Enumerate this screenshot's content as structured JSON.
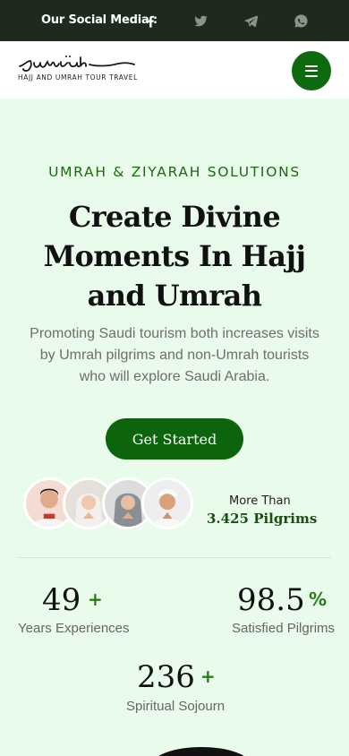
{
  "topbar": {
    "social_label": "Our Social Media :",
    "icons": [
      "facebook-icon",
      "twitter-icon",
      "telegram-icon",
      "whatsapp-icon"
    ]
  },
  "header": {
    "logo_text": "Jumrah",
    "logo_tagline": "HAJJ AND UMRAH TOUR TRAVEL",
    "menu_icon": "hamburger-menu-icon"
  },
  "hero": {
    "eyebrow": "UMRAH & ZIYARAH SOLUTIONS",
    "headline_lines": [
      "Create Divine",
      "Moments In Hajj",
      "and Umrah"
    ],
    "description": "Promoting Saudi tourism both increases visits by Umrah pilgrims and non-Umrah tourists who will explore Saudi Arabia.",
    "cta_label": "Get Started"
  },
  "pilgrims": {
    "more_than": "More Than",
    "count_text": "3.425 Pilgrims"
  },
  "stats": [
    {
      "value": "49",
      "suffix": "+",
      "label": "Years Experiences"
    },
    {
      "value": "98.5",
      "suffix": "%",
      "label": "Satisfied Pilgrims"
    },
    {
      "value": "236",
      "suffix": "+",
      "label": "Spiritual Sojourn"
    }
  ],
  "colors": {
    "brand_green": "#0c640c",
    "accent_green": "#2a7b1c",
    "page_bg": "#e9fbea",
    "topbar_bg": "#1f2a1e"
  }
}
